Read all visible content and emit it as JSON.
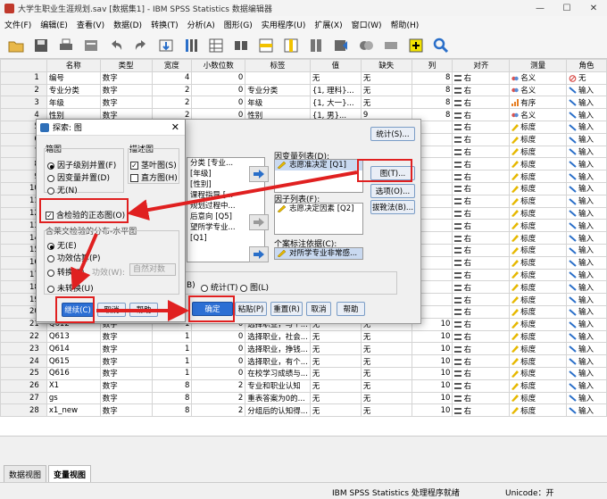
{
  "window": {
    "title": "大学生职业生涯规划.sav [数据集1] - IBM SPSS Statistics 数据编辑器"
  },
  "menu": [
    "文件(F)",
    "编辑(E)",
    "查看(V)",
    "数据(D)",
    "转换(T)",
    "分析(A)",
    "图形(G)",
    "实用程序(U)",
    "扩展(X)",
    "窗口(W)",
    "帮助(H)"
  ],
  "toolbar_icons": [
    "open-folder-icon",
    "save-icon",
    "print-icon",
    "dialog-recall-icon",
    "undo-icon",
    "redo-icon",
    "goto-case-icon",
    "goto-variable-icon",
    "variables-icon",
    "find-icon",
    "insert-cases-icon",
    "insert-variable-icon",
    "split-file-icon",
    "weight-cases-icon",
    "select-cases-icon",
    "value-labels-icon",
    "use-sets-icon",
    "search-icon"
  ],
  "grid": {
    "headers": [
      "",
      "名称",
      "类型",
      "宽度",
      "小数位数",
      "标签",
      "值",
      "缺失",
      "列",
      "对齐",
      "测量",
      "角色"
    ],
    "rows": [
      [
        "1",
        "编号",
        "数字",
        "4",
        "0",
        "",
        "无",
        "无",
        "8",
        "右",
        "名义",
        "无"
      ],
      [
        "2",
        "专业分类",
        "数字",
        "2",
        "0",
        "专业分类",
        "{1, 理科}...",
        "无",
        "8",
        "右",
        "名义",
        "输入"
      ],
      [
        "3",
        "年级",
        "数字",
        "2",
        "0",
        "年级",
        "{1, 大一}...",
        "无",
        "8",
        "右",
        "有序",
        "输入"
      ],
      [
        "4",
        "性别",
        "数字",
        "2",
        "0",
        "性别",
        "{1, 男}...",
        "9",
        "8",
        "右",
        "名义",
        "输入"
      ],
      [
        "5",
        "",
        "",
        "",
        "",
        "",
        "",
        "",
        "",
        "右",
        "标度",
        "输入"
      ],
      [
        "6",
        "",
        "",
        "",
        "",
        "",
        "",
        "",
        "",
        "右",
        "标度",
        "输入"
      ],
      [
        "7",
        "",
        "",
        "",
        "",
        "",
        "",
        "",
        "",
        "右",
        "标度",
        "输入"
      ],
      [
        "8",
        "",
        "",
        "",
        "",
        "",
        "",
        "",
        "",
        "右",
        "标度",
        "输入"
      ],
      [
        "9",
        "",
        "",
        "",
        "",
        "",
        "",
        "",
        "",
        "右",
        "标度",
        "输入"
      ],
      [
        "10",
        "",
        "",
        "",
        "",
        "",
        "",
        "",
        "",
        "右",
        "标度",
        "输入"
      ],
      [
        "11",
        "",
        "",
        "",
        "",
        "",
        "",
        "",
        "",
        "右",
        "标度",
        "输入"
      ],
      [
        "12",
        "",
        "",
        "",
        "",
        "",
        "",
        "",
        "",
        "右",
        "标度",
        "输入"
      ],
      [
        "13",
        "",
        "",
        "",
        "",
        "",
        "",
        "",
        "",
        "右",
        "标度",
        "输入"
      ],
      [
        "14",
        "",
        "",
        "",
        "",
        "",
        "",
        "",
        "",
        "右",
        "标度",
        "输入"
      ],
      [
        "15",
        "",
        "",
        "",
        "",
        "",
        "",
        "",
        "",
        "右",
        "标度",
        "输入"
      ],
      [
        "16",
        "",
        "",
        "",
        "",
        "",
        "",
        "",
        "",
        "右",
        "标度",
        "输入"
      ],
      [
        "17",
        "",
        "",
        "",
        "",
        "",
        "",
        "",
        "",
        "右",
        "标度",
        "输入"
      ],
      [
        "18",
        "",
        "",
        "",
        "",
        "",
        "",
        "",
        "",
        "右",
        "标度",
        "输入"
      ],
      [
        "19",
        "",
        "",
        "",
        "",
        "",
        "",
        "",
        "",
        "右",
        "标度",
        "输入"
      ],
      [
        "20",
        "",
        "",
        "",
        "",
        "",
        "",
        "",
        "",
        "右",
        "标度",
        "输入"
      ],
      [
        "21",
        "Q612",
        "数字",
        "1",
        "0",
        "选择职业，与个...",
        "无",
        "无",
        "10",
        "右",
        "标度",
        "输入"
      ],
      [
        "22",
        "Q613",
        "数字",
        "1",
        "0",
        "选择职业，社会...",
        "无",
        "无",
        "10",
        "右",
        "标度",
        "输入"
      ],
      [
        "23",
        "Q614",
        "数字",
        "1",
        "0",
        "选择职业，挣钱...",
        "无",
        "无",
        "10",
        "右",
        "标度",
        "输入"
      ],
      [
        "24",
        "Q615",
        "数字",
        "1",
        "0",
        "选择职业，有个...",
        "无",
        "无",
        "10",
        "右",
        "标度",
        "输入"
      ],
      [
        "25",
        "Q616",
        "数字",
        "1",
        "0",
        "在校学习成绩与...",
        "无",
        "无",
        "10",
        "右",
        "标度",
        "输入"
      ],
      [
        "26",
        "X1",
        "数字",
        "8",
        "2",
        "专业和职业认知",
        "无",
        "无",
        "10",
        "右",
        "标度",
        "输入"
      ],
      [
        "27",
        "gs",
        "数字",
        "8",
        "2",
        "重表答案为0的...",
        "无",
        "无",
        "10",
        "右",
        "标度",
        "输入"
      ],
      [
        "28",
        "x1_new",
        "数字",
        "8",
        "2",
        "分组后的认知得...",
        "无",
        "无",
        "10",
        "右",
        "标度",
        "输入"
      ]
    ],
    "partial": {
      "r19_name": "Q",
      "r20_name": "Q",
      "r20_label": "选择职业，与个..."
    }
  },
  "tabs": [
    "数据视图",
    "变量视图"
  ],
  "status": {
    "processor": "IBM SPSS Statistics 处理程序就绪",
    "unicode": "Unicode：开"
  },
  "explore": {
    "dep_label": "因变量列表(D):",
    "dep_item": "志愿准决定 [Q1]",
    "factor_label": "因子列表(F):",
    "factor_item": "志愿决定因素 [Q2]",
    "case_label": "个案标注依据(C):",
    "case_item": "对所学专业非常感...",
    "btn_stats": "统计(S)...",
    "btn_plots": "图(T)...",
    "btn_options": "选项(O)...",
    "btn_bootstrap": "拔靴法(B)...",
    "list_items": [
      "分类 [专业...",
      "[年级]",
      "[性别]",
      "课程指导 [...",
      "规划过程中...",
      "后意向 [Q5]",
      "望所学专业...",
      "[Q1]"
    ],
    "display_both": "B)",
    "display_stats": "统计(T)",
    "display_plots": "图(L)",
    "btn_ok": "确定",
    "btn_paste": "粘贴(P)",
    "btn_reset": "重置(R)",
    "btn_cancel": "取消",
    "btn_help": "帮助"
  },
  "plots": {
    "title": "探索: 图",
    "boxplot_group": "箱图",
    "box_opt1": "因子级别并置(F)",
    "box_opt2": "因变量并置(D)",
    "box_opt3": "无(N)",
    "desc_group": "描述图",
    "desc_opt1": "茎叶图(S)",
    "desc_opt2": "直方图(H)",
    "normal_check": "含检验的正态图(O)",
    "spread_group": "含莱文检验的分布-水平图",
    "spread_opt1": "无(E)",
    "spread_opt2": "功效估算(P)",
    "spread_opt3": "转换(T)",
    "power_label": "功效(W):",
    "power_value": "自然对数",
    "spread_opt4": "未转换(U)",
    "btn_continue": "继续(C)",
    "btn_cancel": "取消",
    "btn_help": "帮助"
  },
  "colors": {
    "highlight": "#e02020",
    "primary": "#2c6fd4",
    "selected_field": "#c9d9f0"
  }
}
